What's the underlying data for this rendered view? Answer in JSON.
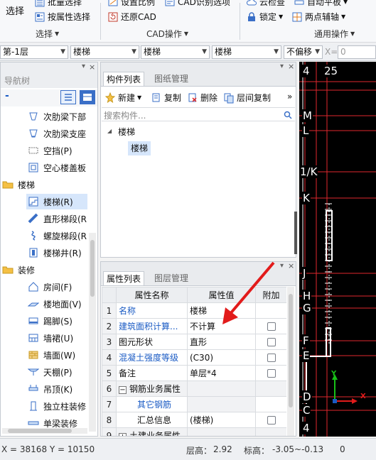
{
  "ribbon": {
    "select_group": {
      "big_select": "选择",
      "batch_select": "批量选择",
      "attr_select": "按属性选择",
      "label": "选择"
    },
    "cad_group": {
      "set_scale": "设置比例",
      "cad_options": "CAD识别选项",
      "restore_cad": "还原CAD",
      "label": "CAD操作"
    },
    "general_group": {
      "cloud_check": "云检查",
      "auto_level": "自动平板",
      "lock": "锁定",
      "two_point_aux": "两点辅轴",
      "label": "通用操作"
    }
  },
  "layerbar": {
    "floor": "第-1层",
    "category": "楼梯",
    "type": "楼梯",
    "component": "楼梯",
    "offset_mode": "不偏移",
    "x_label": "X=",
    "x_value": "0"
  },
  "nav": {
    "title": "导航树",
    "collapse_symbol": "-",
    "items_top": [
      {
        "label": "次肋梁下部",
        "icon": "beam-lower-icon"
      },
      {
        "label": "次肋梁支座",
        "icon": "beam-support-icon"
      },
      {
        "label": "空挡(P)",
        "icon": "opening-icon"
      },
      {
        "label": "空心楼盖板",
        "icon": "hollow-slab-icon"
      }
    ],
    "category_stairs": "楼梯",
    "stairs_items": [
      {
        "label": "楼梯(R)",
        "icon": "stair-icon"
      },
      {
        "label": "直形梯段(R",
        "icon": "straight-flight-icon"
      },
      {
        "label": "螺旋梯段(R",
        "icon": "spiral-flight-icon"
      },
      {
        "label": "楼梯井(R)",
        "icon": "stairwell-icon"
      }
    ],
    "category_decor": "装修",
    "decor_items": [
      {
        "label": "房间(F)",
        "icon": "room-icon"
      },
      {
        "label": "楼地面(V)",
        "icon": "floor-icon"
      },
      {
        "label": "踢脚(S)",
        "icon": "skirting-icon"
      },
      {
        "label": "墙裙(U)",
        "icon": "dado-icon"
      },
      {
        "label": "墙面(W)",
        "icon": "wall-surface-icon"
      },
      {
        "label": "天棚(P)",
        "icon": "ceiling-icon"
      },
      {
        "label": "吊顶(K)",
        "icon": "suspended-ceiling-icon"
      },
      {
        "label": "独立柱装修",
        "icon": "column-finish-icon"
      },
      {
        "label": "单梁装修",
        "icon": "beam-finish-icon"
      }
    ]
  },
  "component_list": {
    "tab_active": "构件列表",
    "tab_inactive": "图纸管理",
    "new_label": "新建",
    "copy_label": "复制",
    "delete_label": "删除",
    "floor_copy_label": "层间复制",
    "more_symbol": "»",
    "search_placeholder": "搜索构件...",
    "tree_root": "楼梯",
    "tree_child": "楼梯"
  },
  "properties": {
    "tab_active": "属性列表",
    "tab_inactive": "图层管理",
    "headers": [
      "属性名称",
      "属性值",
      "附加"
    ],
    "rows": [
      {
        "num": "1",
        "name": "名称",
        "value": "楼梯",
        "blue": true,
        "check": false
      },
      {
        "num": "2",
        "name": "建筑面积计算...",
        "value": "不计算",
        "blue": true,
        "check": true
      },
      {
        "num": "3",
        "name": "图元形状",
        "value": "直形",
        "blue": false,
        "check": true
      },
      {
        "num": "4",
        "name": "混凝土强度等级",
        "value": "(C30)",
        "blue": true,
        "check": true
      },
      {
        "num": "5",
        "name": "备注",
        "value": "单层*4",
        "blue": false,
        "check": true
      },
      {
        "num": "6",
        "name": "钢筋业务属性",
        "value": "",
        "blue": false,
        "check": false,
        "expander": "−"
      },
      {
        "num": "7",
        "name": "其它钢筋",
        "value": "",
        "blue": true,
        "check": false,
        "indent": true
      },
      {
        "num": "8",
        "name": "汇总信息",
        "value": "(楼梯)",
        "blue": false,
        "check": true,
        "indent": true
      },
      {
        "num": "9",
        "name": "土建业务属性",
        "value": "",
        "blue": false,
        "check": false,
        "expander": "+"
      }
    ]
  },
  "cad": {
    "axis_labels": [
      "4",
      "25",
      "M",
      "L",
      "1/K",
      "K",
      "J",
      "H",
      "G",
      "F",
      "E",
      "D",
      "C",
      "4"
    ],
    "ucs_x": "X",
    "ucs_y": "Y"
  },
  "status": {
    "coords": "X = 38168 Y = 10150",
    "floor_height_label": "层高：",
    "floor_height": "2.92",
    "elevation_label": "标高：",
    "elevation": "-3.05~-0.13",
    "extra": "0"
  },
  "colors": {
    "accent_blue": "#1a5bc4",
    "cad_background": "#000000",
    "axis_red": "#e0282e",
    "arrow_red": "#e21b1b"
  }
}
